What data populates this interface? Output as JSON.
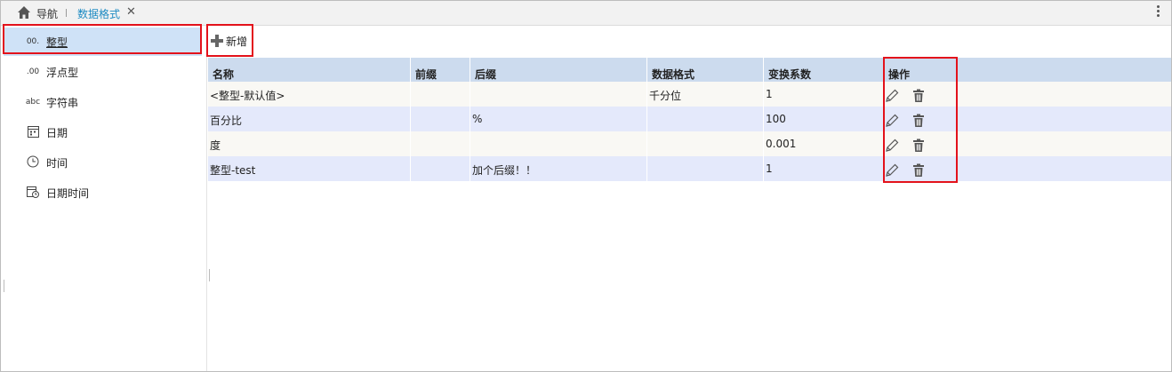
{
  "topbar": {
    "nav_label": "导航",
    "active_tab": "数据格式",
    "close_glyph": "✕"
  },
  "sidebar": {
    "items": [
      {
        "icon": "00.",
        "label": "整型",
        "active": true
      },
      {
        "icon": ".00",
        "label": "浮点型"
      },
      {
        "icon": "abc",
        "label": "字符串"
      },
      {
        "icon": "calendar-icon",
        "label": "日期"
      },
      {
        "icon": "clock-icon",
        "label": "时间"
      },
      {
        "icon": "datetime-icon",
        "label": "日期时间"
      }
    ]
  },
  "toolbar": {
    "add_label": "新增"
  },
  "table": {
    "headers": [
      "名称",
      "前缀",
      "后缀",
      "数据格式",
      "变换系数",
      "操作"
    ],
    "rows": [
      [
        "<整型-默认值>",
        "",
        "",
        "千分位",
        "1"
      ],
      [
        "百分比",
        "",
        "%",
        "",
        "100"
      ],
      [
        "度",
        "",
        "",
        "",
        "0.001"
      ],
      [
        "整型-test",
        "",
        "加个后缀！！",
        "",
        "1"
      ]
    ]
  },
  "colors": {
    "accent": "#1e8bc3",
    "highlight": "#e3121b",
    "header_bg": "#ccdbee",
    "row_alt": "#e4e9fb",
    "selected_bg": "#cfe2f7"
  }
}
